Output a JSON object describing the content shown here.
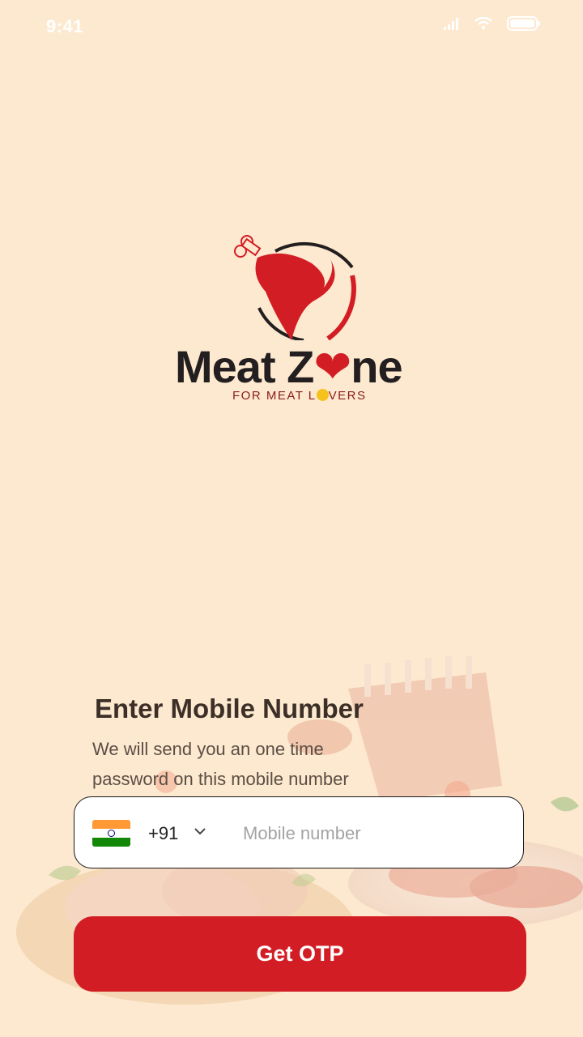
{
  "status_bar": {
    "time": "9:41"
  },
  "brand": {
    "name_part1": "Meat Z",
    "name_part2": "ne",
    "tagline_part1": "FOR MEAT L",
    "tagline_part2": "VERS",
    "accent_color": "#d31d25"
  },
  "login": {
    "title": "Enter Mobile Number",
    "subtitle": "We will send you an one time password on this mobile number",
    "country_flag": "india-flag-icon",
    "country_code": "+91",
    "mobile_placeholder": "Mobile number",
    "mobile_value": "",
    "submit_label": "Get OTP"
  }
}
